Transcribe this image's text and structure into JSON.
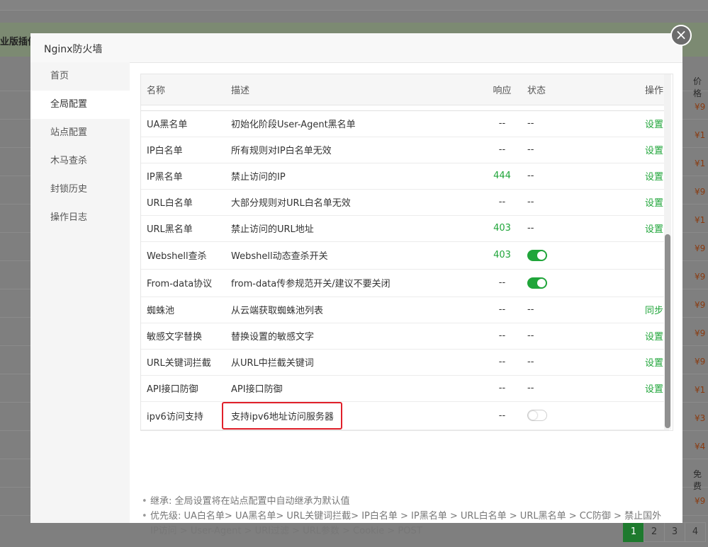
{
  "background": {
    "band_text": "业版插件",
    "right_header": "价格",
    "prices": [
      "¥9",
      "¥1",
      "¥1",
      "¥9",
      "¥1",
      "¥9",
      "¥9",
      "¥9",
      "¥9",
      "¥9",
      "¥1",
      "¥3",
      "¥4"
    ],
    "free_text": "免费",
    "extra_price": "¥9",
    "pagination": {
      "pages": [
        "1",
        "2",
        "3",
        "4"
      ],
      "current": "1"
    }
  },
  "modal": {
    "title": "Nginx防火墙",
    "close_symbol": "×",
    "sidebar": {
      "items": [
        {
          "label": "首页",
          "active": false
        },
        {
          "label": "全局配置",
          "active": true
        },
        {
          "label": "站点配置",
          "active": false
        },
        {
          "label": "木马查杀",
          "active": false
        },
        {
          "label": "封锁历史",
          "active": false
        },
        {
          "label": "操作日志",
          "active": false
        }
      ]
    },
    "table": {
      "headers": {
        "name": "名称",
        "desc": "描述",
        "resp": "响应",
        "state": "状态",
        "op": "操作"
      },
      "rows": [
        {
          "name": "UA黑名单",
          "desc": "初始化阶段User-Agent黑名单",
          "resp": "--",
          "state": "--",
          "op": "设置"
        },
        {
          "name": "IP白名单",
          "desc": "所有规则对IP白名单无效",
          "resp": "--",
          "state": "--",
          "op": "设置"
        },
        {
          "name": "IP黑名单",
          "desc": "禁止访问的IP",
          "resp": "444",
          "state": "--",
          "op": "设置"
        },
        {
          "name": "URL白名单",
          "desc": "大部分规则对URL白名单无效",
          "resp": "--",
          "state": "--",
          "op": "设置"
        },
        {
          "name": "URL黑名单",
          "desc": "禁止访问的URL地址",
          "resp": "403",
          "state": "--",
          "op": "设置"
        },
        {
          "name": "Webshell查杀",
          "desc": "Webshell动态查杀开关",
          "resp": "403",
          "state": "on",
          "op": ""
        },
        {
          "name": "From-data协议",
          "desc": "from-data传参规范开关/建议不要关闭",
          "resp": "--",
          "state": "on",
          "op": ""
        },
        {
          "name": "蜘蛛池",
          "desc": "从云端获取蜘蛛池列表",
          "resp": "--",
          "state": "--",
          "op": "同步"
        },
        {
          "name": "敏感文字替换",
          "desc": "替换设置的敏感文字",
          "resp": "--",
          "state": "--",
          "op": "设置"
        },
        {
          "name": "URL关键词拦截",
          "desc": "从URL中拦截关键词",
          "resp": "--",
          "state": "--",
          "op": "设置"
        },
        {
          "name": "API接口防御",
          "desc": "API接口防御",
          "resp": "--",
          "state": "--",
          "op": "设置"
        },
        {
          "name": "ipv6访问支持",
          "desc": "支持ipv6地址访问服务器",
          "resp": "--",
          "state": "off",
          "op": ""
        }
      ]
    },
    "notes": [
      "继承: 全局设置将在站点配置中自动继承为默认值",
      "优先级: UA白名单> UA黑名单> URL关键词拦截> IP白名单 > IP黑名单 > URL白名单 > URL黑名单 > CC防御 > 禁止国外IP访问 > User-Agent > URI过滤 > URL参数 > Cookie > POST"
    ],
    "note_bullet": "•"
  },
  "colors": {
    "accent": "#20a53a",
    "highlight_border": "#e0202a"
  }
}
